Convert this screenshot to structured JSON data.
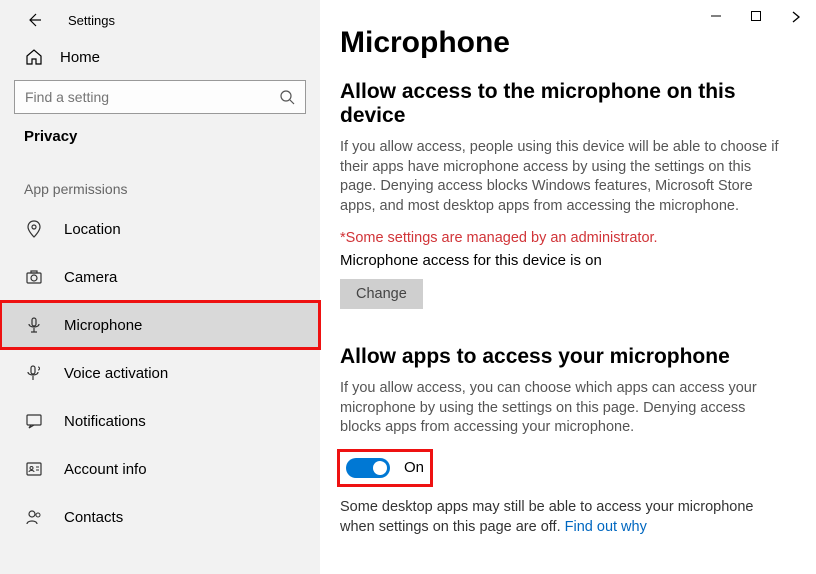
{
  "titlebar": {
    "title": "Settings"
  },
  "home": {
    "label": "Home"
  },
  "search": {
    "placeholder": "Find a setting"
  },
  "category": "Privacy",
  "group_label": "App permissions",
  "nav": {
    "location": "Location",
    "camera": "Camera",
    "microphone": "Microphone",
    "voice_activation": "Voice activation",
    "notifications": "Notifications",
    "account_info": "Account info",
    "contacts": "Contacts"
  },
  "main": {
    "title": "Microphone",
    "section1": {
      "heading": "Allow access to the microphone on this device",
      "desc": "If you allow access, people using this device will be able to choose if their apps have microphone access by using the settings on this page. Denying access blocks Windows features, Microsoft Store apps, and most desktop apps from accessing the microphone.",
      "admin_note": "*Some settings are managed by an administrator.",
      "status": "Microphone access for this device is on",
      "change_btn": "Change"
    },
    "section2": {
      "heading": "Allow apps to access your microphone",
      "desc": "If you allow access, you can choose which apps can access your microphone by using the settings on this page. Denying access blocks apps from accessing your microphone.",
      "toggle_label": "On",
      "footer": "Some desktop apps may still be able to access your microphone when settings on this page are off. ",
      "find_out": "Find out why"
    }
  }
}
